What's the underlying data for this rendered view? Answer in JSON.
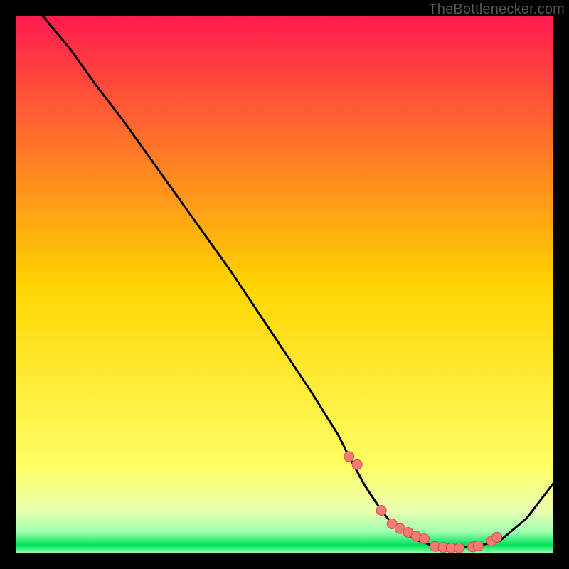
{
  "watermark": "TheBottlenecker.com",
  "colors": {
    "top": "#ff1a4f",
    "mid": "#ffd400",
    "green_center": "#00e05a",
    "curve": "#000000",
    "marker_fill": "#f47a72",
    "marker_stroke": "#c94f48"
  },
  "chart_data": {
    "type": "line",
    "title": "",
    "xlabel": "",
    "ylabel": "",
    "xlim": [
      0,
      100
    ],
    "ylim": [
      0,
      100
    ],
    "curve": {
      "x": [
        5,
        10,
        15,
        20,
        25,
        30,
        35,
        40,
        45,
        50,
        55,
        60,
        62,
        65,
        68,
        70,
        72,
        75,
        78,
        80,
        82,
        85,
        90,
        95,
        100
      ],
      "y": [
        100,
        94,
        87,
        80.5,
        73.5,
        66.5,
        59.5,
        52.5,
        45,
        37.5,
        30,
        22,
        18,
        12.5,
        8,
        5.5,
        4,
        2.3,
        1.3,
        1.0,
        1.0,
        1.2,
        2.3,
        6.5,
        13
      ]
    },
    "markers": {
      "x": [
        62,
        63.5,
        68,
        70,
        71.5,
        73,
        74.5,
        76,
        78,
        79.5,
        81,
        82.5,
        85,
        86,
        88.5,
        89.5
      ],
      "y": [
        18,
        16.5,
        8,
        5.5,
        4.6,
        3.9,
        3.2,
        2.7,
        1.3,
        1.1,
        1.0,
        1.0,
        1.2,
        1.4,
        2.3,
        3.0
      ]
    }
  }
}
